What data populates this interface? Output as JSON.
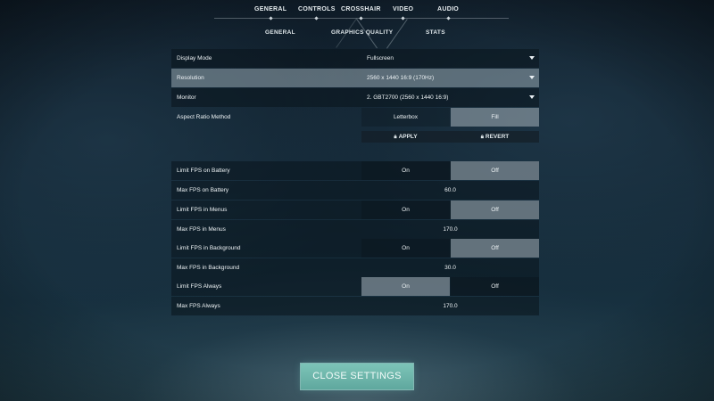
{
  "top_tabs": [
    {
      "label": "GENERAL"
    },
    {
      "label": "CONTROLS"
    },
    {
      "label": "CROSSHAIR"
    },
    {
      "label": "VIDEO"
    },
    {
      "label": "AUDIO"
    }
  ],
  "sub_tabs": [
    {
      "label": "GENERAL"
    },
    {
      "label": "GRAPHICS QUALITY"
    },
    {
      "label": "STATS"
    }
  ],
  "settings": {
    "display_mode": {
      "label": "Display Mode",
      "value": "Fullscreen"
    },
    "resolution": {
      "label": "Resolution",
      "value": "2560 x 1440 16:9 (170Hz)"
    },
    "monitor": {
      "label": "Monitor",
      "value": "2. GBT2700 (2560 x 1440 16:9)"
    },
    "aspect_ratio": {
      "label": "Aspect Ratio Method",
      "option_a": "Letterbox",
      "option_b": "Fill",
      "selected": "Fill"
    },
    "apply_label": "APPLY",
    "revert_label": "REVERT",
    "limit_fps_battery": {
      "label": "Limit FPS on Battery",
      "on": "On",
      "off": "Off",
      "selected": "Off"
    },
    "max_fps_battery": {
      "label": "Max FPS on Battery",
      "value": "60.0"
    },
    "limit_fps_menus": {
      "label": "Limit FPS in Menus",
      "on": "On",
      "off": "Off",
      "selected": "Off"
    },
    "max_fps_menus": {
      "label": "Max FPS in Menus",
      "value": "170.0"
    },
    "limit_fps_background": {
      "label": "Limit FPS in Background",
      "on": "On",
      "off": "Off",
      "selected": "Off"
    },
    "max_fps_background": {
      "label": "Max FPS in Background",
      "value": "30.0"
    },
    "limit_fps_always": {
      "label": "Limit FPS Always",
      "on": "On",
      "off": "Off",
      "selected": "On"
    },
    "max_fps_always": {
      "label": "Max FPS Always",
      "value": "170.0"
    }
  },
  "close_label": "CLOSE SETTINGS",
  "colors": {
    "accent": "#6fb8ad",
    "active_segment": "#8796a0",
    "row_bg": "#0a141c"
  },
  "icons": {
    "lock": "lock-icon",
    "dropdown": "chevron-down-icon",
    "tab_indicator": "diamond-indicator-icon"
  }
}
